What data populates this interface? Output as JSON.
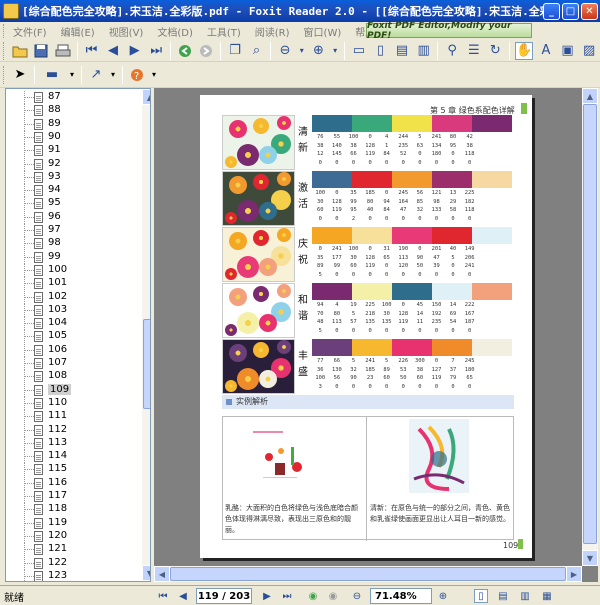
{
  "window": {
    "title": "[综合配色完全攻略].宋玉洁.全彩版.pdf - Foxit Reader 2.0 - [[综合配色完全攻略].宋玉洁.全彩版...",
    "minimize": "_",
    "restore": "□",
    "close": "✕"
  },
  "menubar": {
    "items": [
      "文件(F)",
      "编辑(E)",
      "视图(V)",
      "文档(D)",
      "工具(T)",
      "阅读(R)",
      "窗口(W)",
      "帮助(H)"
    ],
    "ad_text": "Foxit PDF Editor,Modify your PDF!"
  },
  "sidebar": {
    "pages": [
      "87",
      "88",
      "89",
      "90",
      "91",
      "92",
      "93",
      "94",
      "95",
      "96",
      "97",
      "98",
      "99",
      "100",
      "101",
      "102",
      "103",
      "104",
      "105",
      "106",
      "107",
      "108",
      "109",
      "110",
      "111",
      "112",
      "113",
      "114",
      "115",
      "116",
      "117",
      "118",
      "119",
      "120",
      "121",
      "122",
      "123"
    ],
    "selected": "109"
  },
  "document_page": {
    "header": "第 5 章   绿色系配色详解",
    "rows": [
      {
        "name": "清新",
        "colors": [
          "#2e6d8c",
          "#39a87a",
          "#f2e24a",
          "#d9397d",
          "#7a2a6e"
        ],
        "nums": [
          [
            "76",
            "55",
            "100",
            "0",
            "4",
            "244",
            "5",
            "241",
            "80",
            "42"
          ],
          [
            "38",
            "140",
            "38",
            "128",
            "1",
            "235",
            "63",
            "134",
            "95",
            "38"
          ],
          [
            "12",
            "145",
            "66",
            "119",
            "84",
            "52",
            "0",
            "180",
            "0",
            "118"
          ],
          [
            "0",
            "0",
            "0",
            "0",
            "0",
            "0",
            "0",
            "0",
            "0",
            "0"
          ]
        ]
      },
      {
        "name": "激活",
        "colors": [
          "#3e6a96",
          "#e0262f",
          "#f39a2e",
          "#9c2f6b",
          "#f6d9a0"
        ],
        "nums": [
          [
            "100",
            "0",
            "35",
            "185",
            "0",
            "245",
            "56",
            "121",
            "13",
            "225"
          ],
          [
            "30",
            "128",
            "99",
            "80",
            "94",
            "164",
            "85",
            "98",
            "29",
            "182"
          ],
          [
            "60",
            "119",
            "95",
            "40",
            "84",
            "47",
            "32",
            "133",
            "58",
            "118"
          ],
          [
            "0",
            "0",
            "2",
            "0",
            "0",
            "0",
            "0",
            "0",
            "0",
            "0"
          ]
        ]
      },
      {
        "name": "庆祝",
        "colors": [
          "#f5a623",
          "#f6e09a",
          "#e83a76",
          "#e0262f",
          "#dff0f7"
        ],
        "nums": [
          [
            "0",
            "241",
            "100",
            "0",
            "31",
            "190",
            "0",
            "201",
            "40",
            "149"
          ],
          [
            "35",
            "177",
            "30",
            "128",
            "65",
            "113",
            "90",
            "47",
            "5",
            "206"
          ],
          [
            "89",
            "99",
            "60",
            "119",
            "0",
            "120",
            "50",
            "39",
            "0",
            "241"
          ],
          [
            "5",
            "0",
            "0",
            "0",
            "0",
            "0",
            "0",
            "0",
            "0",
            "0"
          ]
        ]
      },
      {
        "name": "和谐",
        "colors": [
          "#7a2a6e",
          "#f5f0a8",
          "#2e6d8c",
          "#dff0f7",
          "#f3a07c"
        ],
        "nums": [
          [
            "94",
            "4",
            "19",
            "225",
            "100",
            "0",
            "45",
            "150",
            "14",
            "222"
          ],
          [
            "70",
            "80",
            "5",
            "218",
            "30",
            "128",
            "14",
            "192",
            "69",
            "167"
          ],
          [
            "48",
            "113",
            "57",
            "135",
            "135",
            "119",
            "11",
            "235",
            "54",
            "187"
          ],
          [
            "5",
            "0",
            "0",
            "0",
            "0",
            "0",
            "0",
            "0",
            "0",
            "0"
          ]
        ]
      },
      {
        "name": "丰盛",
        "colors": [
          "#6b3f7a",
          "#f5b82e",
          "#e8316f",
          "#f08b2a",
          "#f3efe0"
        ],
        "nums": [
          [
            "77",
            "66",
            "5",
            "241",
            "5",
            "226",
            "300",
            "0",
            "7",
            "245"
          ],
          [
            "36",
            "130",
            "32",
            "185",
            "89",
            "53",
            "38",
            "127",
            "37",
            "180"
          ],
          [
            "100",
            "56",
            "90",
            "23",
            "60",
            "50",
            "60",
            "119",
            "79",
            "65"
          ],
          [
            "3",
            "0",
            "0",
            "0",
            "0",
            "0",
            "0",
            "0",
            "0",
            "0"
          ]
        ]
      }
    ],
    "section_title": "实例解析",
    "caption_left": "乳酪：大面积的白色将绿色与浅色底暗合颜色体现得淋漓尽致，表现出三原色和的靓丽。",
    "caption_right": "清新：在原色与统一的部分之间，青色、黄色和乳雀绿使画面更显出让人耳目一新的感觉。",
    "footer_page": "109"
  },
  "statusbar": {
    "status": "就绪",
    "page_indicator": "119 / 203",
    "zoom": "71.48%"
  }
}
